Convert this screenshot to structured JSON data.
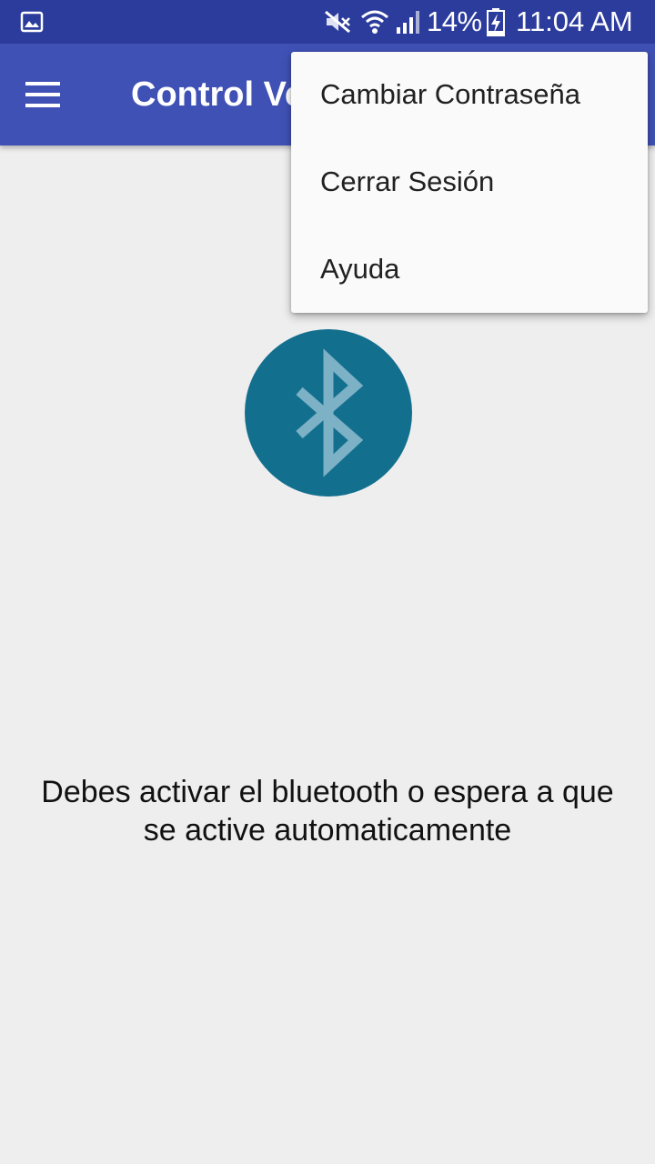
{
  "status_bar": {
    "battery_percent": "14%",
    "time": "11:04 AM",
    "icons": [
      "gallery-icon",
      "mute-icon",
      "wifi-icon",
      "signal-icon",
      "battery-charging-icon"
    ]
  },
  "app_bar": {
    "title": "Control Ve",
    "menu_icon": "hamburger-menu-icon",
    "color": "#3f51b5"
  },
  "overflow_menu": {
    "items": [
      {
        "label": "Cambiar Contraseña"
      },
      {
        "label": "Cerrar Sesión"
      },
      {
        "label": "Ayuda"
      }
    ]
  },
  "main": {
    "bluetooth_icon": "bluetooth-icon",
    "bluetooth_color": "#136f8e",
    "message": "Debes activar el bluetooth o espera a que se active automaticamente"
  }
}
